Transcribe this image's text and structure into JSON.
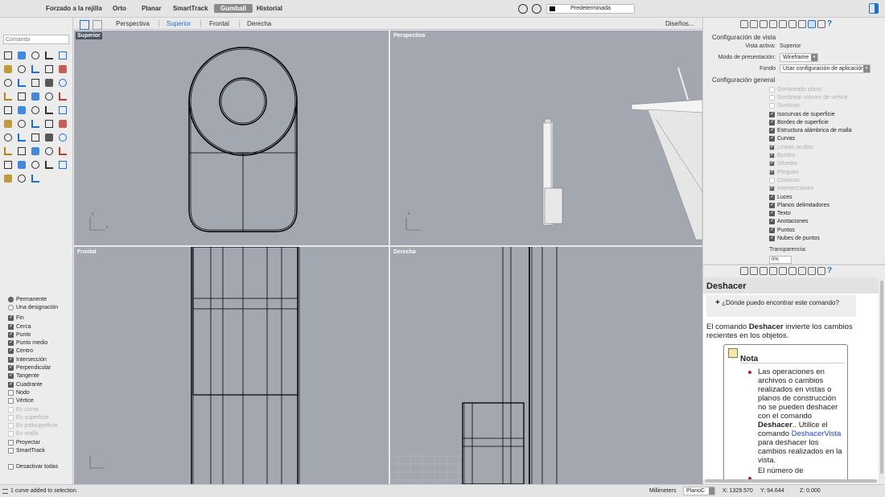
{
  "topbar": {
    "items": [
      "Forzado a la rejilla",
      "Orto",
      "Planar",
      "SmartTrack",
      "Gumball",
      "Historial"
    ],
    "active": "Gumball",
    "preset": "Predeterminada"
  },
  "viewtabs": {
    "tabs": [
      "Perspectiva",
      "Superior",
      "Frontal",
      "Derecha"
    ],
    "active": "Superior",
    "layouts": "Diseños..."
  },
  "command": {
    "placeholder": "Comando"
  },
  "viewports": {
    "top_left": "Superior",
    "top_right": "Perspectiva",
    "bottom_left": "Frontal",
    "bottom_right": "Derecha"
  },
  "osnap": {
    "radios": [
      {
        "label": "Permanente",
        "on": true
      },
      {
        "label": "Una designación",
        "on": false
      }
    ],
    "items": [
      {
        "label": "Fin",
        "checked": true,
        "disabled": false
      },
      {
        "label": "Cerca",
        "checked": true,
        "disabled": false
      },
      {
        "label": "Punto",
        "checked": true,
        "disabled": false
      },
      {
        "label": "Punto medio",
        "checked": true,
        "disabled": false
      },
      {
        "label": "Centro",
        "checked": true,
        "disabled": false
      },
      {
        "label": "Intersección",
        "checked": true,
        "disabled": false
      },
      {
        "label": "Perpendicular",
        "checked": true,
        "disabled": false
      },
      {
        "label": "Tangente",
        "checked": true,
        "disabled": false
      },
      {
        "label": "Cuadrante",
        "checked": true,
        "disabled": false
      },
      {
        "label": "Nodo",
        "checked": false,
        "disabled": false
      },
      {
        "label": "Vértice",
        "checked": false,
        "disabled": false
      },
      {
        "label": "En curva",
        "checked": false,
        "disabled": true
      },
      {
        "label": "En superficie",
        "checked": false,
        "disabled": true
      },
      {
        "label": "En polisuperficie",
        "checked": false,
        "disabled": true
      },
      {
        "label": "En malla",
        "checked": false,
        "disabled": true
      },
      {
        "label": "Proyectar",
        "checked": false,
        "disabled": false
      },
      {
        "label": "SmartTrack",
        "checked": false,
        "disabled": false
      }
    ],
    "disable_all": "Desactivar todas"
  },
  "view_config": {
    "title": "Configuración de vista",
    "active_view_label": "Vista activa:",
    "active_view_value": "Superior",
    "display_mode_label": "Modo de presentación:",
    "display_mode_value": "Wireframe",
    "background_label": "Fondo",
    "background_value": "Usar configuración de aplicación",
    "general_title": "Configuración general",
    "checks": [
      {
        "label": "Sombreado plano",
        "checked": false,
        "disabled": true
      },
      {
        "label": "Sombrear colores de vértice",
        "checked": false,
        "disabled": true
      },
      {
        "label": "Sombras",
        "checked": false,
        "disabled": true
      },
      {
        "label": "Isocurvas de superficie",
        "checked": true,
        "disabled": false
      },
      {
        "label": "Bordes de superficie",
        "checked": true,
        "disabled": false
      },
      {
        "label": "Estructura alámbrica de malla",
        "checked": true,
        "disabled": false
      },
      {
        "label": "Curvas",
        "checked": true,
        "disabled": false
      },
      {
        "label": "Líneas ocultas",
        "checked": true,
        "disabled": true
      },
      {
        "label": "Bordes",
        "checked": true,
        "disabled": true
      },
      {
        "label": "Siluetas",
        "checked": true,
        "disabled": true
      },
      {
        "label": "Pliegues",
        "checked": true,
        "disabled": true
      },
      {
        "label": "Costuras",
        "checked": false,
        "disabled": true
      },
      {
        "label": "Intersecciones",
        "checked": true,
        "disabled": true
      },
      {
        "label": "Luces",
        "checked": true,
        "disabled": false
      },
      {
        "label": "Planos delimitadores",
        "checked": true,
        "disabled": false
      },
      {
        "label": "Texto",
        "checked": true,
        "disabled": false
      },
      {
        "label": "Anotaciones",
        "checked": true,
        "disabled": false
      },
      {
        "label": "Puntos",
        "checked": true,
        "disabled": false
      },
      {
        "label": "Nubes de puntos",
        "checked": true,
        "disabled": false
      }
    ],
    "transparency_label": "Transparencia:",
    "transparency_value": "0%"
  },
  "help": {
    "title": "Deshacer",
    "where_prefix": "+",
    "where_text": "¿Dónde puedo encontrar este comando?",
    "intro_pre": "El comando ",
    "intro_cmd": "Deshacer",
    "intro_post": " invierte los cambios recientes en los objetos.",
    "note_title": "Nota",
    "note_p1": "Las operaciones en archivos o cambios realizados en vistas o planos de construcción no se pueden deshacer con el comando ",
    "note_cmd": "Deshacer",
    "note_p2": ".. Utilice el comando ",
    "note_link": "DeshacerVista",
    "note_p3": " para deshacer los cambios realizados en la vista.",
    "note_p4": "El número de"
  },
  "status": {
    "message": "1 curve added to selection.",
    "units": "Millimeters",
    "plane": "PlanoC",
    "x": "X: 1329.570",
    "y": "Y: 94.644",
    "z": "Z: 0.000"
  },
  "axis": {
    "x": "x",
    "y": "y"
  },
  "colors": {
    "accent": "#1a6fd8",
    "viewport_bg": "#a3a7b0",
    "active_label_bg": "#4a5363"
  }
}
